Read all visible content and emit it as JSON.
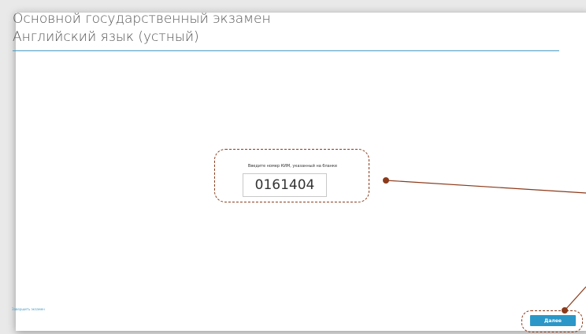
{
  "header": {
    "title_line1": "Основной государственный экзамен",
    "title_line2": "Английский язык (устный)"
  },
  "kim": {
    "caption": "Введите номер КИМ, указанный на бланке",
    "value": "0161404"
  },
  "footer": {
    "finish_link": "Завершить экзамен",
    "next_button": "Далее"
  },
  "colors": {
    "accent": "#2b97c8",
    "callout": "#8b3a1a",
    "rule": "#4a9cc4"
  }
}
